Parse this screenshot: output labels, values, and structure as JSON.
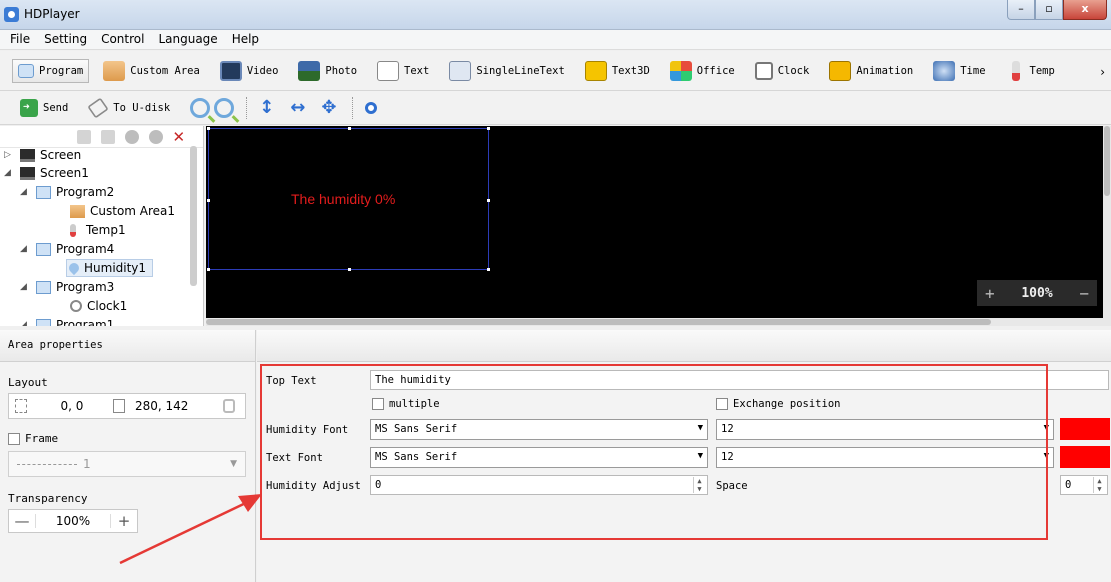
{
  "window": {
    "title": "HDPlayer"
  },
  "menu": [
    "File",
    "Setting",
    "Control",
    "Language",
    "Help"
  ],
  "toolbar1": {
    "program": "Program",
    "custom_area": "Custom Area",
    "video": "Video",
    "photo": "Photo",
    "text": "Text",
    "single_line_text": "SingleLineText",
    "text3d": "Text3D",
    "office": "Office",
    "clock": "Clock",
    "animation": "Animation",
    "time": "Time",
    "temp": "Temp",
    "more": "›"
  },
  "toolbar2": {
    "send": "Send",
    "to_udisk": "To U-disk"
  },
  "tree": {
    "items": [
      {
        "label": "Screen"
      },
      {
        "label": "Screen1"
      },
      {
        "label": "Program2"
      },
      {
        "label": "Custom Area1"
      },
      {
        "label": "Temp1"
      },
      {
        "label": "Program4"
      },
      {
        "label": "Humidity1"
      },
      {
        "label": "Program3"
      },
      {
        "label": "Clock1"
      },
      {
        "label": "Program1"
      }
    ]
  },
  "canvas": {
    "area_text": "The humidity 0%",
    "zoom": "100%",
    "zoom_in": "+",
    "zoom_out": "−"
  },
  "area_properties": {
    "title": "Area properties",
    "layout_label": "Layout",
    "position": "0, 0",
    "size": "280, 142",
    "frame_label": "Frame",
    "frame_value": "1",
    "transparency_label": "Transparency",
    "transparency_value": "100%"
  },
  "humidity_props": {
    "top_text_label": "Top Text",
    "top_text_value": "The humidity",
    "multiple_label": "multiple",
    "exchange_label": "Exchange position",
    "humidity_font_label": "Humidity Font",
    "humidity_font_value": "MS Sans Serif",
    "humidity_font_size": "12",
    "text_font_label": "Text Font",
    "text_font_value": "MS Sans Serif",
    "text_font_size": "12",
    "humidity_adjust_label": "Humidity Adjust",
    "humidity_adjust_value": "0",
    "space_label": "Space",
    "space_value": "0",
    "font_color": "#ff0000"
  }
}
